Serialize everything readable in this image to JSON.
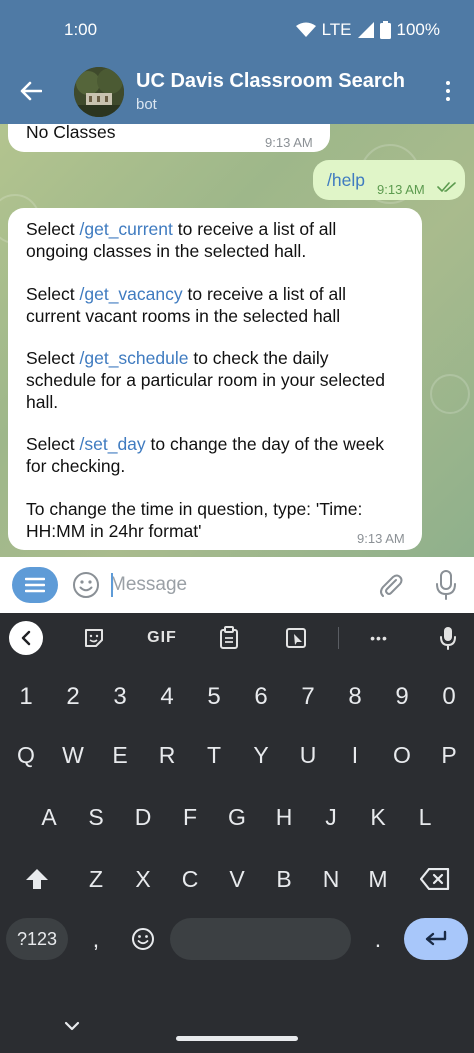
{
  "status": {
    "time": "1:00",
    "network": "LTE",
    "battery": "100%"
  },
  "header": {
    "title": "UC Davis Classroom Search",
    "subtitle": "bot"
  },
  "messages": [
    {
      "lines": [
        "No Classes"
      ],
      "time": "9:13 AM"
    },
    {
      "text": "/help",
      "time": "9:13 AM"
    },
    {
      "time": "9:13 AM",
      "p1": {
        "pre": "Select ",
        "cmd": "/get_current",
        "l1": " to receive a list of all",
        "l2": "ongoing classes in the selected hall."
      },
      "p2": {
        "pre": "Select ",
        "cmd": "/get_vacancy",
        "l1": " to receive a list of all",
        "l2": "current vacant rooms in the selected hall"
      },
      "p3": {
        "pre": "Select ",
        "cmd": "/get_schedule",
        "l1": " to check the daily",
        "l2": "schedule for a particular room in your selected",
        "l3": "hall."
      },
      "p4": {
        "pre": "Select ",
        "cmd": "/set_day",
        "l1": " to change the day of the week",
        "l2": "for checking."
      },
      "p5": {
        "l1": "To change the time in question, type: 'Time:",
        "l2": "HH:MM in 24hr format'"
      }
    }
  ],
  "composer": {
    "placeholder": "Message"
  },
  "keyboard_toolbar": {
    "gif": "GIF",
    "more": "•••"
  },
  "keyboard": {
    "row_numbers": [
      "1",
      "2",
      "3",
      "4",
      "5",
      "6",
      "7",
      "8",
      "9",
      "0"
    ],
    "row1": [
      "Q",
      "W",
      "E",
      "R",
      "T",
      "Y",
      "U",
      "I",
      "O",
      "P"
    ],
    "row2": [
      "A",
      "S",
      "D",
      "F",
      "G",
      "H",
      "J",
      "K",
      "L"
    ],
    "row3": [
      "Z",
      "X",
      "C",
      "V",
      "B",
      "N",
      "M"
    ],
    "symbols": "?123",
    "comma": ",",
    "period": "."
  },
  "colors": {
    "header": "#4f7aa5",
    "incoming_bubble": "#ffffff",
    "outgoing_bubble": "#e0f5c8",
    "command_link": "#3f7bc0",
    "enter_key": "#a8c7fa"
  }
}
